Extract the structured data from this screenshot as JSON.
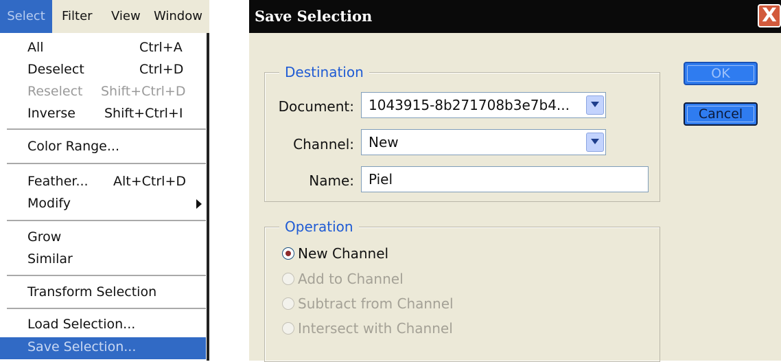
{
  "menubar": {
    "items": [
      "Select",
      "Filter",
      "View",
      "Window"
    ],
    "active": "Select"
  },
  "select_menu": {
    "items": [
      {
        "label": "All",
        "shortcut": "Ctrl+A"
      },
      {
        "label": "Deselect",
        "shortcut": "Ctrl+D"
      },
      {
        "label": "Reselect",
        "shortcut": "Shift+Ctrl+D",
        "disabled": true
      },
      {
        "label": "Inverse",
        "shortcut": "Shift+Ctrl+I"
      },
      {
        "label": "Color Range..."
      },
      {
        "label": "Feather...",
        "shortcut": "Alt+Ctrl+D"
      },
      {
        "label": "Modify",
        "submenu": true
      },
      {
        "label": "Grow"
      },
      {
        "label": "Similar"
      },
      {
        "label": "Transform Selection"
      },
      {
        "label": "Load Selection..."
      },
      {
        "label": "Save Selection...",
        "highlighted": true
      }
    ]
  },
  "dialog": {
    "title": "Save Selection",
    "close_label": "X",
    "destination": {
      "legend": "Destination",
      "document_label": "Document:",
      "document_value": "1043915-8b271708b3e7b4...",
      "channel_label": "Channel:",
      "channel_value": "New",
      "name_label": "Name:",
      "name_value": "Piel"
    },
    "operation": {
      "legend": "Operation",
      "options": [
        "New Channel",
        "Add to Channel",
        "Subtract from Channel",
        "Intersect with Channel"
      ],
      "selected": "New Channel"
    },
    "buttons": {
      "ok": "OK",
      "cancel": "Cancel"
    }
  },
  "colors": {
    "menu_highlight": "#316ac5",
    "dialog_background": "#ece9d8",
    "legend_text": "#1f5bd4",
    "button_blue": "#2f7cf0"
  }
}
